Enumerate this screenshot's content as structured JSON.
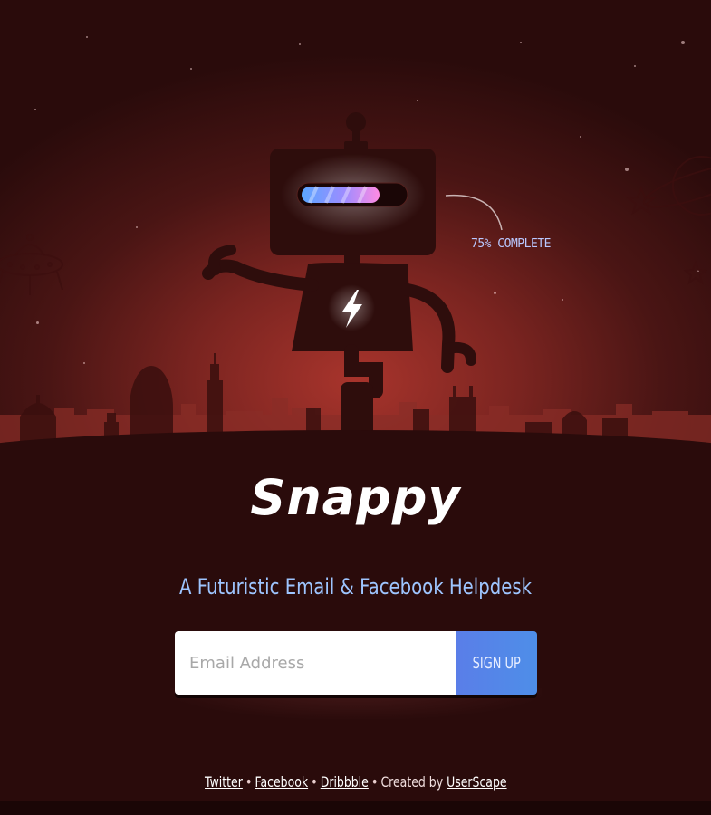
{
  "brand": {
    "logo_text": "Snappy",
    "tagline": "A Futuristic Email & Facebook Helpdesk"
  },
  "robot": {
    "progress_label": "75% COMPLETE",
    "progress_value": 0.75,
    "chest_icon": "lightning-bolt-icon"
  },
  "signup": {
    "email_placeholder": "Email Address",
    "email_value": "",
    "button_label": "SIGN UP"
  },
  "footer": {
    "twitter": "Twitter",
    "sep1": "•",
    "facebook": "Facebook",
    "sep2": "•",
    "dribbble": "Dribbble",
    "sep3": "•",
    "created_by": "Created by",
    "userscape": "UserScape"
  },
  "colors": {
    "sky": "#7a2420",
    "ground": "#2a0b0b",
    "accent_blue": "#9ec5ff",
    "button": "#5a7ee8"
  }
}
